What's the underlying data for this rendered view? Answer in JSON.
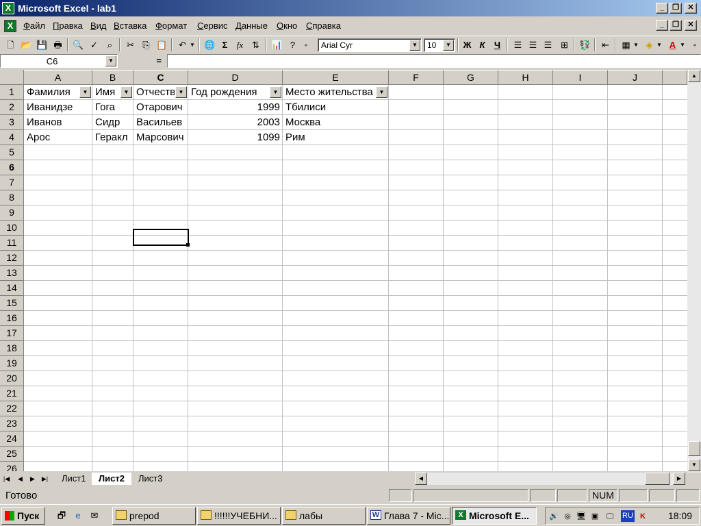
{
  "window": {
    "title": "Microsoft Excel - lab1",
    "minimize": "_",
    "restore": "❐",
    "close": "✕"
  },
  "menu": [
    "Файл",
    "Правка",
    "Вид",
    "Вставка",
    "Формат",
    "Сервис",
    "Данные",
    "Окно",
    "Справка"
  ],
  "toolbar": {
    "font_name": "Arial Cyr",
    "font_size": "10",
    "sigma": "Σ",
    "fx": "fx",
    "bold": "Ж",
    "italic": "К",
    "underline": "Ч"
  },
  "formula_bar": {
    "name_box": "C6",
    "equals": "=",
    "content": ""
  },
  "columns": [
    "A",
    "B",
    "C",
    "D",
    "E",
    "F",
    "G",
    "H",
    "I",
    "J"
  ],
  "active_column": "C",
  "rows": [
    "1",
    "2",
    "3",
    "4",
    "5",
    "6",
    "7",
    "8",
    "9",
    "10",
    "11",
    "12",
    "13",
    "14",
    "15",
    "16",
    "17",
    "18",
    "19",
    "20",
    "21",
    "22",
    "23",
    "24",
    "25",
    "26"
  ],
  "active_row": "6",
  "table": {
    "headers": [
      "Фамилия",
      "Имя",
      "Отчество",
      "Год рождения",
      "Место жительства"
    ],
    "records": [
      [
        "Иванидзе",
        "Гога",
        "Отарович",
        "1999",
        "Тбилиси"
      ],
      [
        "Иванов",
        "Сидр",
        "Васильев",
        "2003",
        "Москва"
      ],
      [
        "Арос",
        "Геракл",
        "Марсович",
        "1099",
        "Рим"
      ]
    ]
  },
  "sheets": [
    "Лист1",
    "Лист2",
    "Лист3"
  ],
  "active_sheet": "Лист2",
  "status": {
    "ready": "Готово",
    "num": "NUM"
  },
  "taskbar": {
    "start": "Пуск",
    "tasks": [
      "prepod",
      "!!!!!!УЧЕБНИ...",
      "лабы",
      "Глава 7 - Mic...",
      "Microsoft E..."
    ],
    "active_task": "Microsoft E...",
    "language": "RU",
    "clock": "18:09"
  }
}
